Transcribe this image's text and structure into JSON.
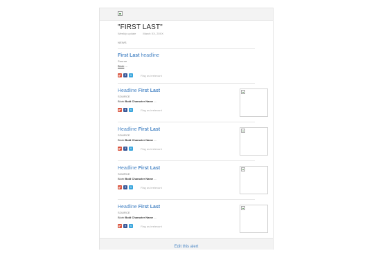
{
  "alert": {
    "title": "\"FIRST LAST\"",
    "frequency": "Weekly update",
    "date": "March XX, 20XX",
    "section": "NEWS"
  },
  "items": [
    {
      "headline_bold": "First Last",
      "headline_rest": " headline",
      "source": "Source",
      "blurb_prefix": "Blurb",
      "blurb_bold": "",
      "blurb_suffix": " ...",
      "flag": "Flag as irrelevant",
      "has_thumb": false
    },
    {
      "headline_prefix": "Headline ",
      "headline_bold": "First Last",
      "source": "SOURCE",
      "blurb_prefix": "Blurb ",
      "blurb_bold": "Bold Character Name",
      "blurb_suffix": " ...",
      "flag": "Flag as irrelevant",
      "has_thumb": true
    },
    {
      "headline_prefix": "Headline ",
      "headline_bold": "First Last",
      "source": "SOURCE",
      "blurb_prefix": "Blurb ",
      "blurb_bold": "Bold Character Name",
      "blurb_suffix": " ...",
      "flag": "Flag as irrelevant",
      "has_thumb": true
    },
    {
      "headline_prefix": "Headline ",
      "headline_bold": "First Last",
      "source": "SOURCE",
      "blurb_prefix": "Blurb ",
      "blurb_bold": "Bold Character Name",
      "blurb_suffix": " ...",
      "flag": "Flag as irrelevant",
      "has_thumb": true
    },
    {
      "headline_prefix": "Headline ",
      "headline_bold": "First Last",
      "source": "SOURCE",
      "blurb_prefix": "Blurb ",
      "blurb_bold": "Bold Character Name",
      "blurb_suffix": " ...",
      "flag": "Flag as irrelevant",
      "has_thumb": true
    }
  ],
  "share_icons": {
    "gplus": "g+",
    "facebook": "f",
    "twitter": "t"
  },
  "footer": {
    "edit_label": "Edit this alert"
  },
  "colors": {
    "link": "#4a86c5",
    "gplus": "#d9533d",
    "facebook": "#3b5998",
    "twitter": "#3aa6dd"
  }
}
